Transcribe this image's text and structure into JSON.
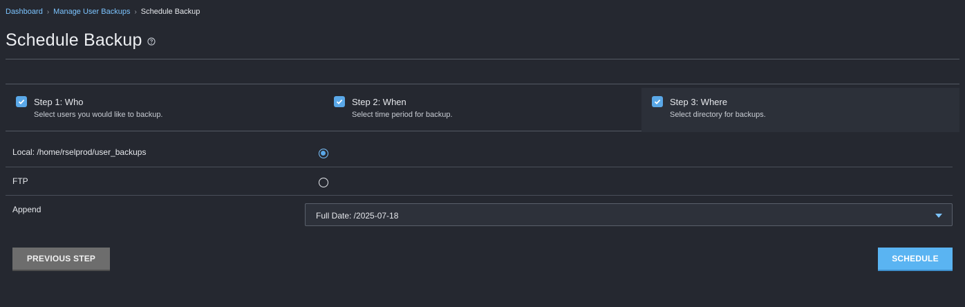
{
  "breadcrumb": {
    "items": [
      "Dashboard",
      "Manage User Backups"
    ],
    "current": "Schedule Backup",
    "separator": "›"
  },
  "page": {
    "title": "Schedule Backup",
    "help_icon": "help-circle-icon"
  },
  "steps": [
    {
      "title": "Step 1: Who",
      "subtitle": "Select users you would like to backup.",
      "checked": true
    },
    {
      "title": "Step 2: When",
      "subtitle": "Select time period for backup.",
      "checked": true
    },
    {
      "title": "Step 3: Where",
      "subtitle": "Select directory for backups.",
      "checked": true,
      "active": true
    }
  ],
  "destinations": {
    "local_label": "Local: /home/rselprod/user_backups",
    "local_selected": true,
    "ftp_label": "FTP",
    "ftp_selected": false
  },
  "append": {
    "label": "Append",
    "selected": "Full Date: /2025-07-18"
  },
  "buttons": {
    "previous": "PREVIOUS STEP",
    "schedule": "SCHEDULE"
  },
  "colors": {
    "background": "#252830",
    "link": "#7cc4ff",
    "accent": "#5ab4f2",
    "secondary_button": "#6d6d6d"
  }
}
